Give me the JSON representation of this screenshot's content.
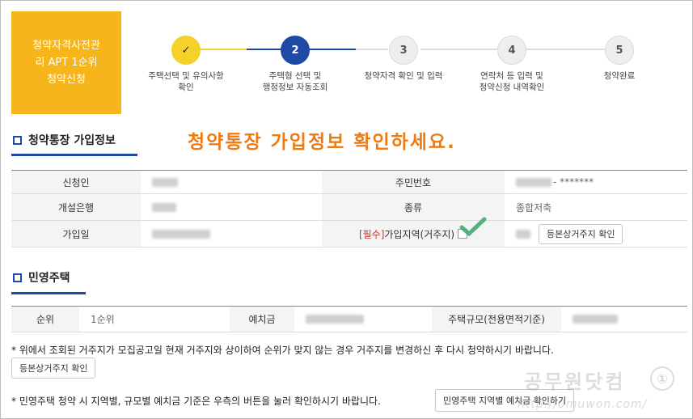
{
  "hero": {
    "title": "청약자격사전관\n리 APT 1순위\n청약신청"
  },
  "steps": [
    {
      "num": "✓",
      "label": "주택선택 및 유의사항\n확인",
      "state": "done"
    },
    {
      "num": "2",
      "label": "주택형 선택 및\n행정정보 자동조회",
      "state": "active"
    },
    {
      "num": "3",
      "label": "청약자격 확인 및 입력",
      "state": "todo"
    },
    {
      "num": "4",
      "label": "연락처 등 입력 및\n청약신청 내역확인",
      "state": "todo"
    },
    {
      "num": "5",
      "label": "청약완료",
      "state": "todo"
    }
  ],
  "section1": {
    "title": "청약통장 가입정보",
    "headline": "청약통장 가입정보 확인하세요."
  },
  "account": {
    "applicant_label": "신청인",
    "resident_label": "주민번호",
    "resident_value_mask": "- *******",
    "bank_label": "개설은행",
    "type_label": "종류",
    "type_value": "종합저축",
    "join_date_label": "가입일",
    "required_tag": "[필수]",
    "region_label": "가입지역(거주지)",
    "address_button": "등본상거주지 확인"
  },
  "section2": {
    "title": "민영주택"
  },
  "private": {
    "rank_label": "순위",
    "rank_value": "1순위",
    "deposit_label": "예치금",
    "size_label": "주택규모(전용면적기준)"
  },
  "notes": {
    "note1": "* 위에서 조회된 거주지가 모집공고일 현재 거주지와 상이하여 순위가 맞지 않는 경우 거주지를 변경하신 후 다시 청약하시기 바랍니다.",
    "note1_button": "등본상거주지 확인",
    "note2": "* 민영주택 청약 시 지역별, 규모별 예치금 기준은 우측의 버튼을 눌러 확인하시기 바랍니다.",
    "note2_button": "민영주택 지역별 예치금 확인하기"
  },
  "watermark": {
    "brand": "공무원닷컴",
    "circle": "①",
    "url": "http://0muwon.com/"
  },
  "colors": {
    "accent_blue": "#1f49a7",
    "hero_yellow": "#f6b51a",
    "done_yellow": "#f6d12a",
    "headline_orange": "#f07a10",
    "check_green": "#3aa56b"
  }
}
